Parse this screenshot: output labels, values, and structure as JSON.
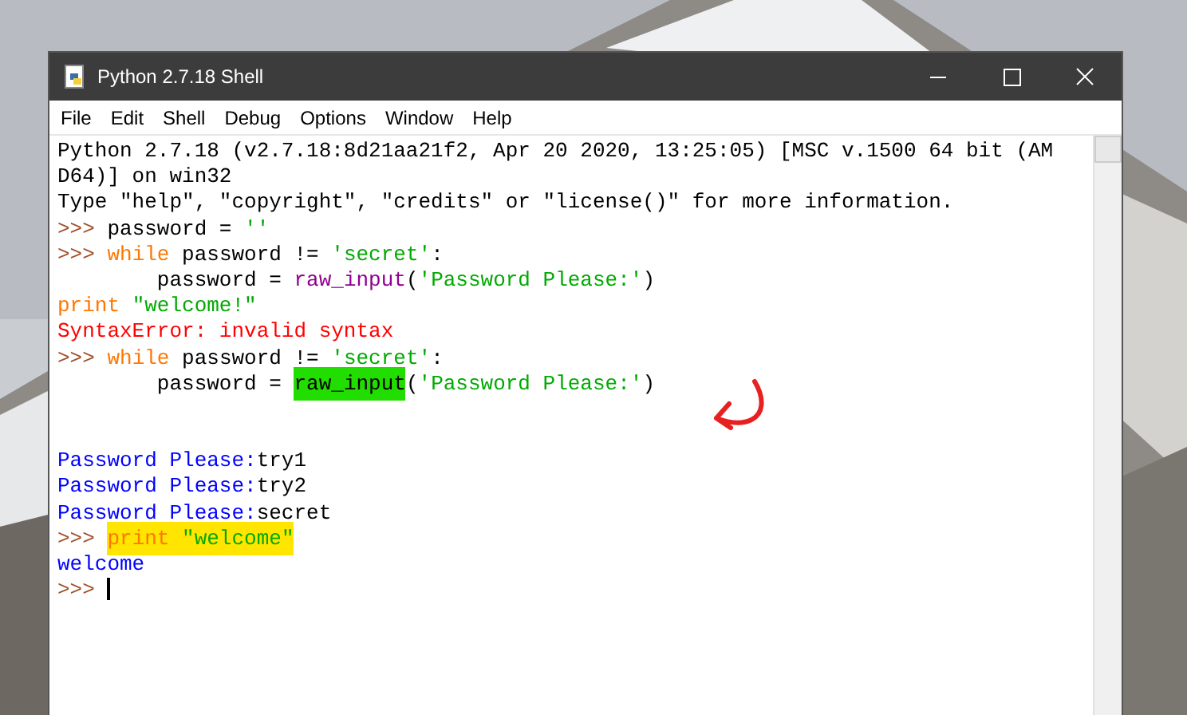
{
  "window": {
    "title": "Python 2.7.18 Shell"
  },
  "menu": [
    "File",
    "Edit",
    "Shell",
    "Debug",
    "Options",
    "Window",
    "Help"
  ],
  "lines": [
    {
      "kind": "code",
      "segments": [
        {
          "kind": "plain",
          "text": "Python 2.7.18 (v2.7.18:8d21aa21f2, Apr 20 2020, 13:25:05) [MSC v.1500 64 bit (AM"
        }
      ]
    },
    {
      "kind": "code",
      "segments": [
        {
          "kind": "plain",
          "text": "D64)] on win32"
        }
      ]
    },
    {
      "kind": "code",
      "segments": [
        {
          "kind": "plain",
          "text": "Type \"help\", \"copyright\", \"credits\" or \"license()\" for more information."
        }
      ]
    },
    {
      "kind": "code",
      "segments": [
        {
          "kind": "prompt",
          "text": ">>> "
        },
        {
          "kind": "plain",
          "text": "password = "
        },
        {
          "kind": "string",
          "text": "''"
        }
      ]
    },
    {
      "kind": "code",
      "segments": [
        {
          "kind": "prompt",
          "text": ">>> "
        },
        {
          "kind": "keyword",
          "text": "while"
        },
        {
          "kind": "plain",
          "text": " password != "
        },
        {
          "kind": "string",
          "text": "'secret'"
        },
        {
          "kind": "plain",
          "text": ":"
        }
      ]
    },
    {
      "kind": "code",
      "segments": [
        {
          "kind": "plain",
          "text": "        password = "
        },
        {
          "kind": "builtin",
          "text": "raw_input"
        },
        {
          "kind": "plain",
          "text": "("
        },
        {
          "kind": "string",
          "text": "'Password Please:'"
        },
        {
          "kind": "plain",
          "text": ")"
        }
      ]
    },
    {
      "kind": "code",
      "segments": [
        {
          "kind": "keyword",
          "text": "print "
        },
        {
          "kind": "string",
          "text": "\"welcome!\""
        }
      ]
    },
    {
      "kind": "code",
      "segments": [
        {
          "kind": "error",
          "text": "SyntaxError: invalid syntax"
        }
      ]
    },
    {
      "kind": "code",
      "segments": [
        {
          "kind": "prompt",
          "text": ">>> "
        },
        {
          "kind": "keyword",
          "text": "while"
        },
        {
          "kind": "plain",
          "text": " password != "
        },
        {
          "kind": "string",
          "text": "'secret'"
        },
        {
          "kind": "plain",
          "text": ":"
        }
      ]
    },
    {
      "kind": "code",
      "segments": [
        {
          "kind": "plain",
          "text": "        password = "
        },
        {
          "kind": "plain",
          "text": "raw_input",
          "color": "#22dd00"
        },
        {
          "kind": "plain",
          "text": "("
        },
        {
          "kind": "string",
          "text": "'Password Please:'"
        },
        {
          "kind": "plain",
          "text": ")"
        }
      ]
    },
    {
      "kind": "blank"
    },
    {
      "kind": "blank"
    },
    {
      "kind": "code",
      "segments": [
        {
          "kind": "stdout",
          "text": "Password Please:"
        },
        {
          "kind": "plain",
          "text": "try1"
        }
      ]
    },
    {
      "kind": "code",
      "segments": [
        {
          "kind": "stdout",
          "text": "Password Please:"
        },
        {
          "kind": "plain",
          "text": "try2"
        }
      ]
    },
    {
      "kind": "code",
      "segments": [
        {
          "kind": "stdout",
          "text": "Password Please:"
        },
        {
          "kind": "plain",
          "text": "secret"
        }
      ]
    },
    {
      "kind": "code",
      "segments": [
        {
          "kind": "prompt",
          "text": ">>> "
        },
        {
          "kind": "keyword",
          "text": "print ",
          "color": "#ffe500"
        },
        {
          "kind": "string",
          "text": "\"welcome\"",
          "color": "#ffe500"
        }
      ]
    },
    {
      "kind": "code",
      "segments": [
        {
          "kind": "stdout",
          "text": "welcome"
        }
      ]
    },
    {
      "kind": "code",
      "segments": [
        {
          "kind": "prompt",
          "text": ">>> "
        },
        {
          "kind": "cursor"
        }
      ]
    }
  ]
}
